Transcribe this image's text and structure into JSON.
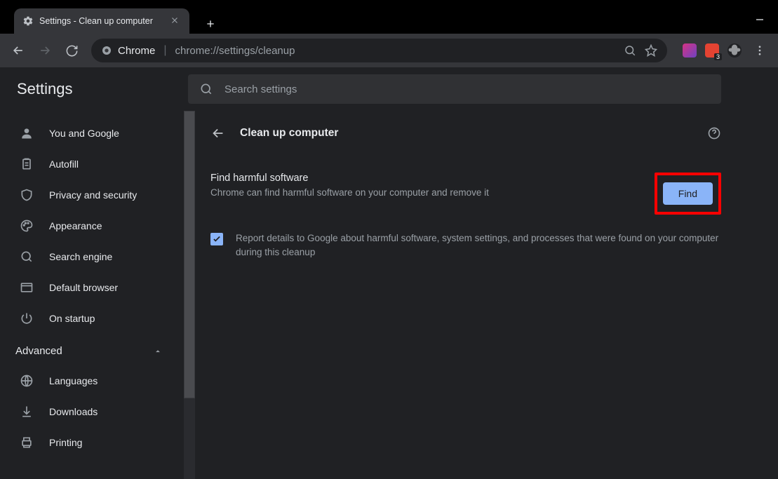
{
  "window": {
    "tab_title": "Settings - Clean up computer"
  },
  "omnibox": {
    "chip_label": "Chrome",
    "url": "chrome://settings/cleanup"
  },
  "ext_badge": "3",
  "settings_title": "Settings",
  "search": {
    "placeholder": "Search settings"
  },
  "sidebar": {
    "items": [
      {
        "label": "You and Google"
      },
      {
        "label": "Autofill"
      },
      {
        "label": "Privacy and security"
      },
      {
        "label": "Appearance"
      },
      {
        "label": "Search engine"
      },
      {
        "label": "Default browser"
      },
      {
        "label": "On startup"
      }
    ],
    "advanced_label": "Advanced",
    "adv_items": [
      {
        "label": "Languages"
      },
      {
        "label": "Downloads"
      },
      {
        "label": "Printing"
      }
    ]
  },
  "section": {
    "title": "Clean up computer"
  },
  "cleanup": {
    "heading": "Find harmful software",
    "sub": "Chrome can find harmful software on your computer and remove it",
    "find_label": "Find",
    "report_label": "Report details to Google about harmful software, system settings, and processes that were found on your computer during this cleanup",
    "report_checked": true
  }
}
